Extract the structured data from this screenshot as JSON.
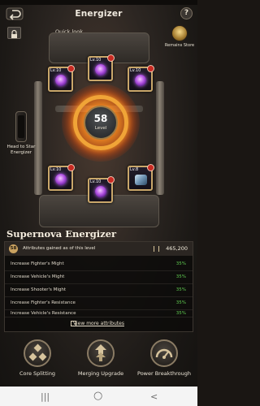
{
  "header": {
    "title": "Energizer",
    "back_icon": "back-arrow-icon",
    "help_label": "?"
  },
  "top": {
    "quick_look": "Quick look",
    "remains_store": "Remains Store",
    "lock_icon": "lock-icon"
  },
  "core": {
    "level": "58",
    "level_label": "Level"
  },
  "slots": [
    {
      "level": "Lv.10",
      "item": "purple-orb-icon"
    },
    {
      "level": "Lv.10",
      "item": "purple-orb-icon"
    },
    {
      "level": "Lv.10",
      "item": "purple-orb-icon"
    },
    {
      "level": "Lv.10",
      "item": "purple-orb-icon"
    },
    {
      "level": "Lv.10",
      "item": "purple-orb-icon"
    },
    {
      "level": "Lv.8",
      "item": "steel-cube-icon"
    }
  ],
  "head_to_star": "Head to Star Energizer",
  "panel": {
    "title": "Supernova Energizer",
    "level_badge": "58",
    "attributes_heading": "Attributes gained as of this level",
    "power": "465,200",
    "attributes": [
      {
        "name": "Increase Fighter's Might",
        "value": "35%"
      },
      {
        "name": "Increase Vehicle's Might",
        "value": "35%"
      },
      {
        "name": "Increase Shooter's Might",
        "value": "35%"
      },
      {
        "name": "Increase Fighter's Resistance",
        "value": "35%"
      },
      {
        "name": "Increase Vehicle's Resistance",
        "value": "35%"
      }
    ],
    "view_more": "View more attributes"
  },
  "actions": [
    {
      "label": "Core Splitting",
      "icon": "core-splitting-icon"
    },
    {
      "label": "Merging Upgrade",
      "icon": "merging-upgrade-icon"
    },
    {
      "label": "Power Breakthrough",
      "icon": "power-breakthrough-icon"
    }
  ],
  "android_nav": {
    "recents": "|||",
    "home": "○",
    "back": "<"
  },
  "colors": {
    "accent_gold": "#c9a76a",
    "percent_green": "#5fc850",
    "core_orange": "#f0a437"
  }
}
